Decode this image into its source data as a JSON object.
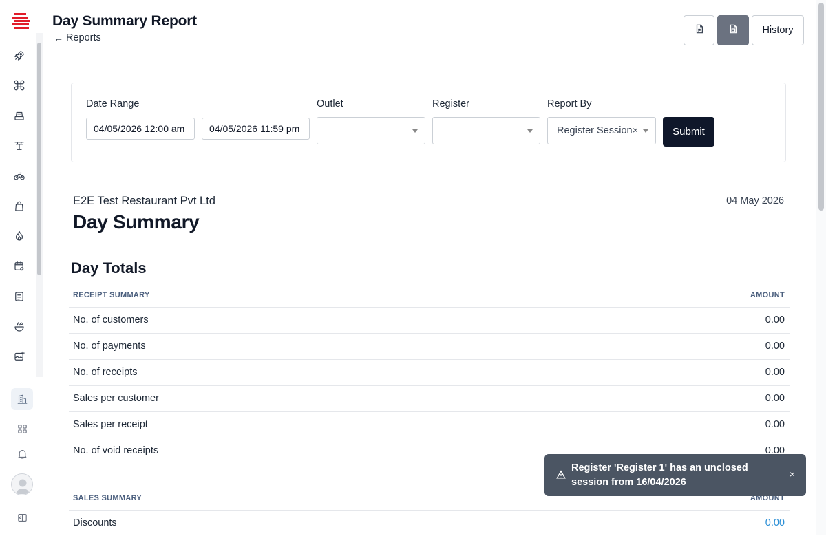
{
  "header": {
    "title": "Day Summary Report",
    "back_label": "Reports",
    "buttons": [
      {
        "icon": "pdf-file-icon",
        "label": ""
      },
      {
        "icon": "spreadsheet-file-icon",
        "label": ""
      },
      {
        "icon": "",
        "label": "History"
      }
    ]
  },
  "sidebar": {
    "items": [
      {
        "icon": "rocket-icon"
      },
      {
        "icon": "command-icon"
      },
      {
        "icon": "cash-register-icon"
      },
      {
        "icon": "table-icon"
      },
      {
        "icon": "bicycle-icon"
      },
      {
        "icon": "shopping-bag-icon"
      },
      {
        "icon": "flame-icon"
      },
      {
        "icon": "calendar-settings-icon"
      },
      {
        "icon": "receipt-icon"
      },
      {
        "icon": "food-bowl-icon"
      },
      {
        "icon": "image-add-icon"
      }
    ],
    "bottom": [
      {
        "icon": "building-icon",
        "active": true
      },
      {
        "icon": "grid-icon",
        "active": false
      },
      {
        "icon": "bell-icon",
        "active": false
      },
      {
        "icon": "panel-toggle-icon",
        "active": false
      }
    ]
  },
  "filters": {
    "date_range_label": "Date Range",
    "date_from": "04/05/2026 12:00 am",
    "date_to": "04/05/2026 11:59 pm",
    "outlet_label": "Outlet",
    "outlet_value": "",
    "register_label": "Register",
    "register_value": "",
    "report_by_label": "Report By",
    "report_by_value": "Register Session",
    "clear_glyph": "×",
    "submit_label": "Submit"
  },
  "report": {
    "company": "E2E Test Restaurant Pvt Ltd",
    "date": "04 May 2026",
    "title": "Day Summary",
    "section_title": "Day Totals",
    "receipt_summary": {
      "header": "RECEIPT SUMMARY",
      "amount_header": "AMOUNT",
      "rows": [
        {
          "label": "No. of customers",
          "value": "0.00"
        },
        {
          "label": "No. of payments",
          "value": "0.00"
        },
        {
          "label": "No. of receipts",
          "value": "0.00"
        },
        {
          "label": "Sales per customer",
          "value": "0.00"
        },
        {
          "label": "Sales per receipt",
          "value": "0.00"
        },
        {
          "label": "No. of void receipts",
          "value": "0.00"
        }
      ]
    },
    "sales_summary": {
      "header": "SALES SUMMARY",
      "amount_header": "AMOUNT",
      "rows": [
        {
          "label": "Discounts",
          "value": "0.00"
        }
      ]
    }
  },
  "toast": {
    "message": "Register 'Register 1' has an unclosed session from 16/04/2026",
    "close_glyph": "×"
  },
  "colors": {
    "primary_dark": "#0f172a",
    "toast_bg": "#4b5563",
    "link": "#2b8fd6",
    "brand_red": "#e11d2a"
  }
}
